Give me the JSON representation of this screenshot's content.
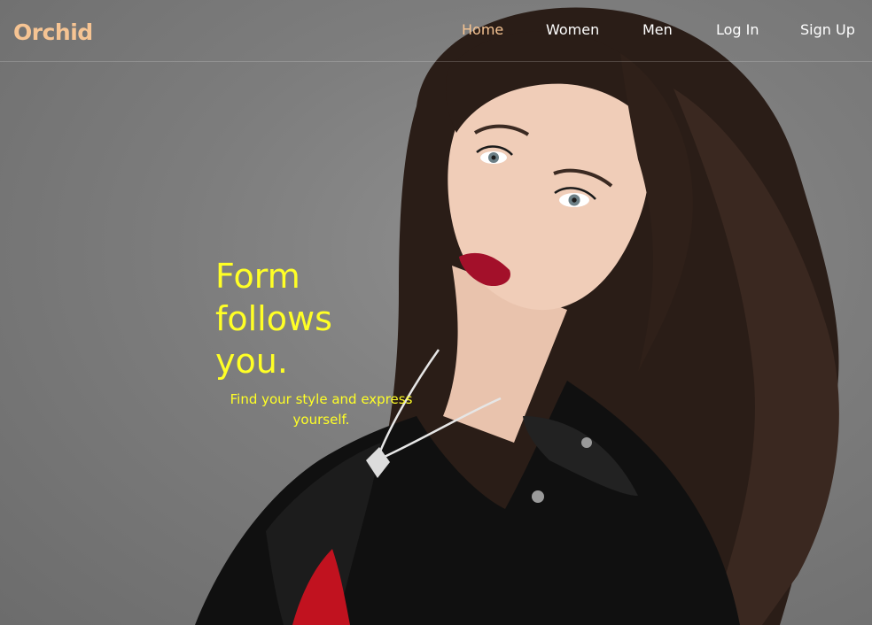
{
  "nav": {
    "brand": "Orchid",
    "links": [
      {
        "label": "Home",
        "active": true
      },
      {
        "label": "Women",
        "active": false
      },
      {
        "label": "Men",
        "active": false
      },
      {
        "label": "Log In",
        "active": false
      },
      {
        "label": "Sign Up",
        "active": false
      }
    ]
  },
  "hero": {
    "headline_lines": [
      "Form",
      "follows",
      "you."
    ],
    "tagline": "Find your style and express yourself."
  },
  "colors": {
    "brand": "#f6c493",
    "active_link": "#f6c493",
    "link": "#ffffff",
    "headline": "#ffff26",
    "background": "#7d7d7d"
  }
}
